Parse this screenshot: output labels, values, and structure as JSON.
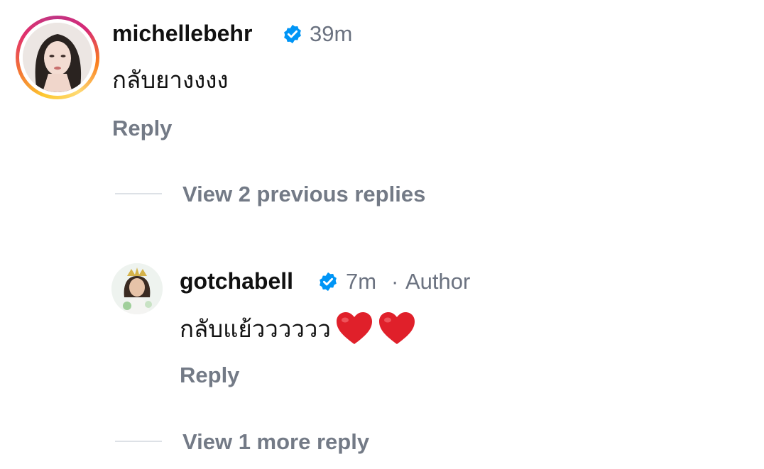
{
  "comments": [
    {
      "username": "michellebehr",
      "verified": true,
      "time": "39m",
      "text": "กลับยางงงง",
      "reply_label": "Reply",
      "view_replies_label": "View 2 previous replies"
    },
    {
      "username": "gotchabell",
      "verified": true,
      "time": "7m",
      "separator": "·",
      "role": "Author",
      "text": "กลับแย้วววววว",
      "emojis": [
        "heart-emoji",
        "heart-emoji"
      ],
      "reply_label": "Reply",
      "view_replies_label": "View 1 more reply"
    }
  ],
  "colors": {
    "verified_badge": "#0095f6",
    "heart": "#e0202a",
    "muted_text": "#737a86"
  }
}
